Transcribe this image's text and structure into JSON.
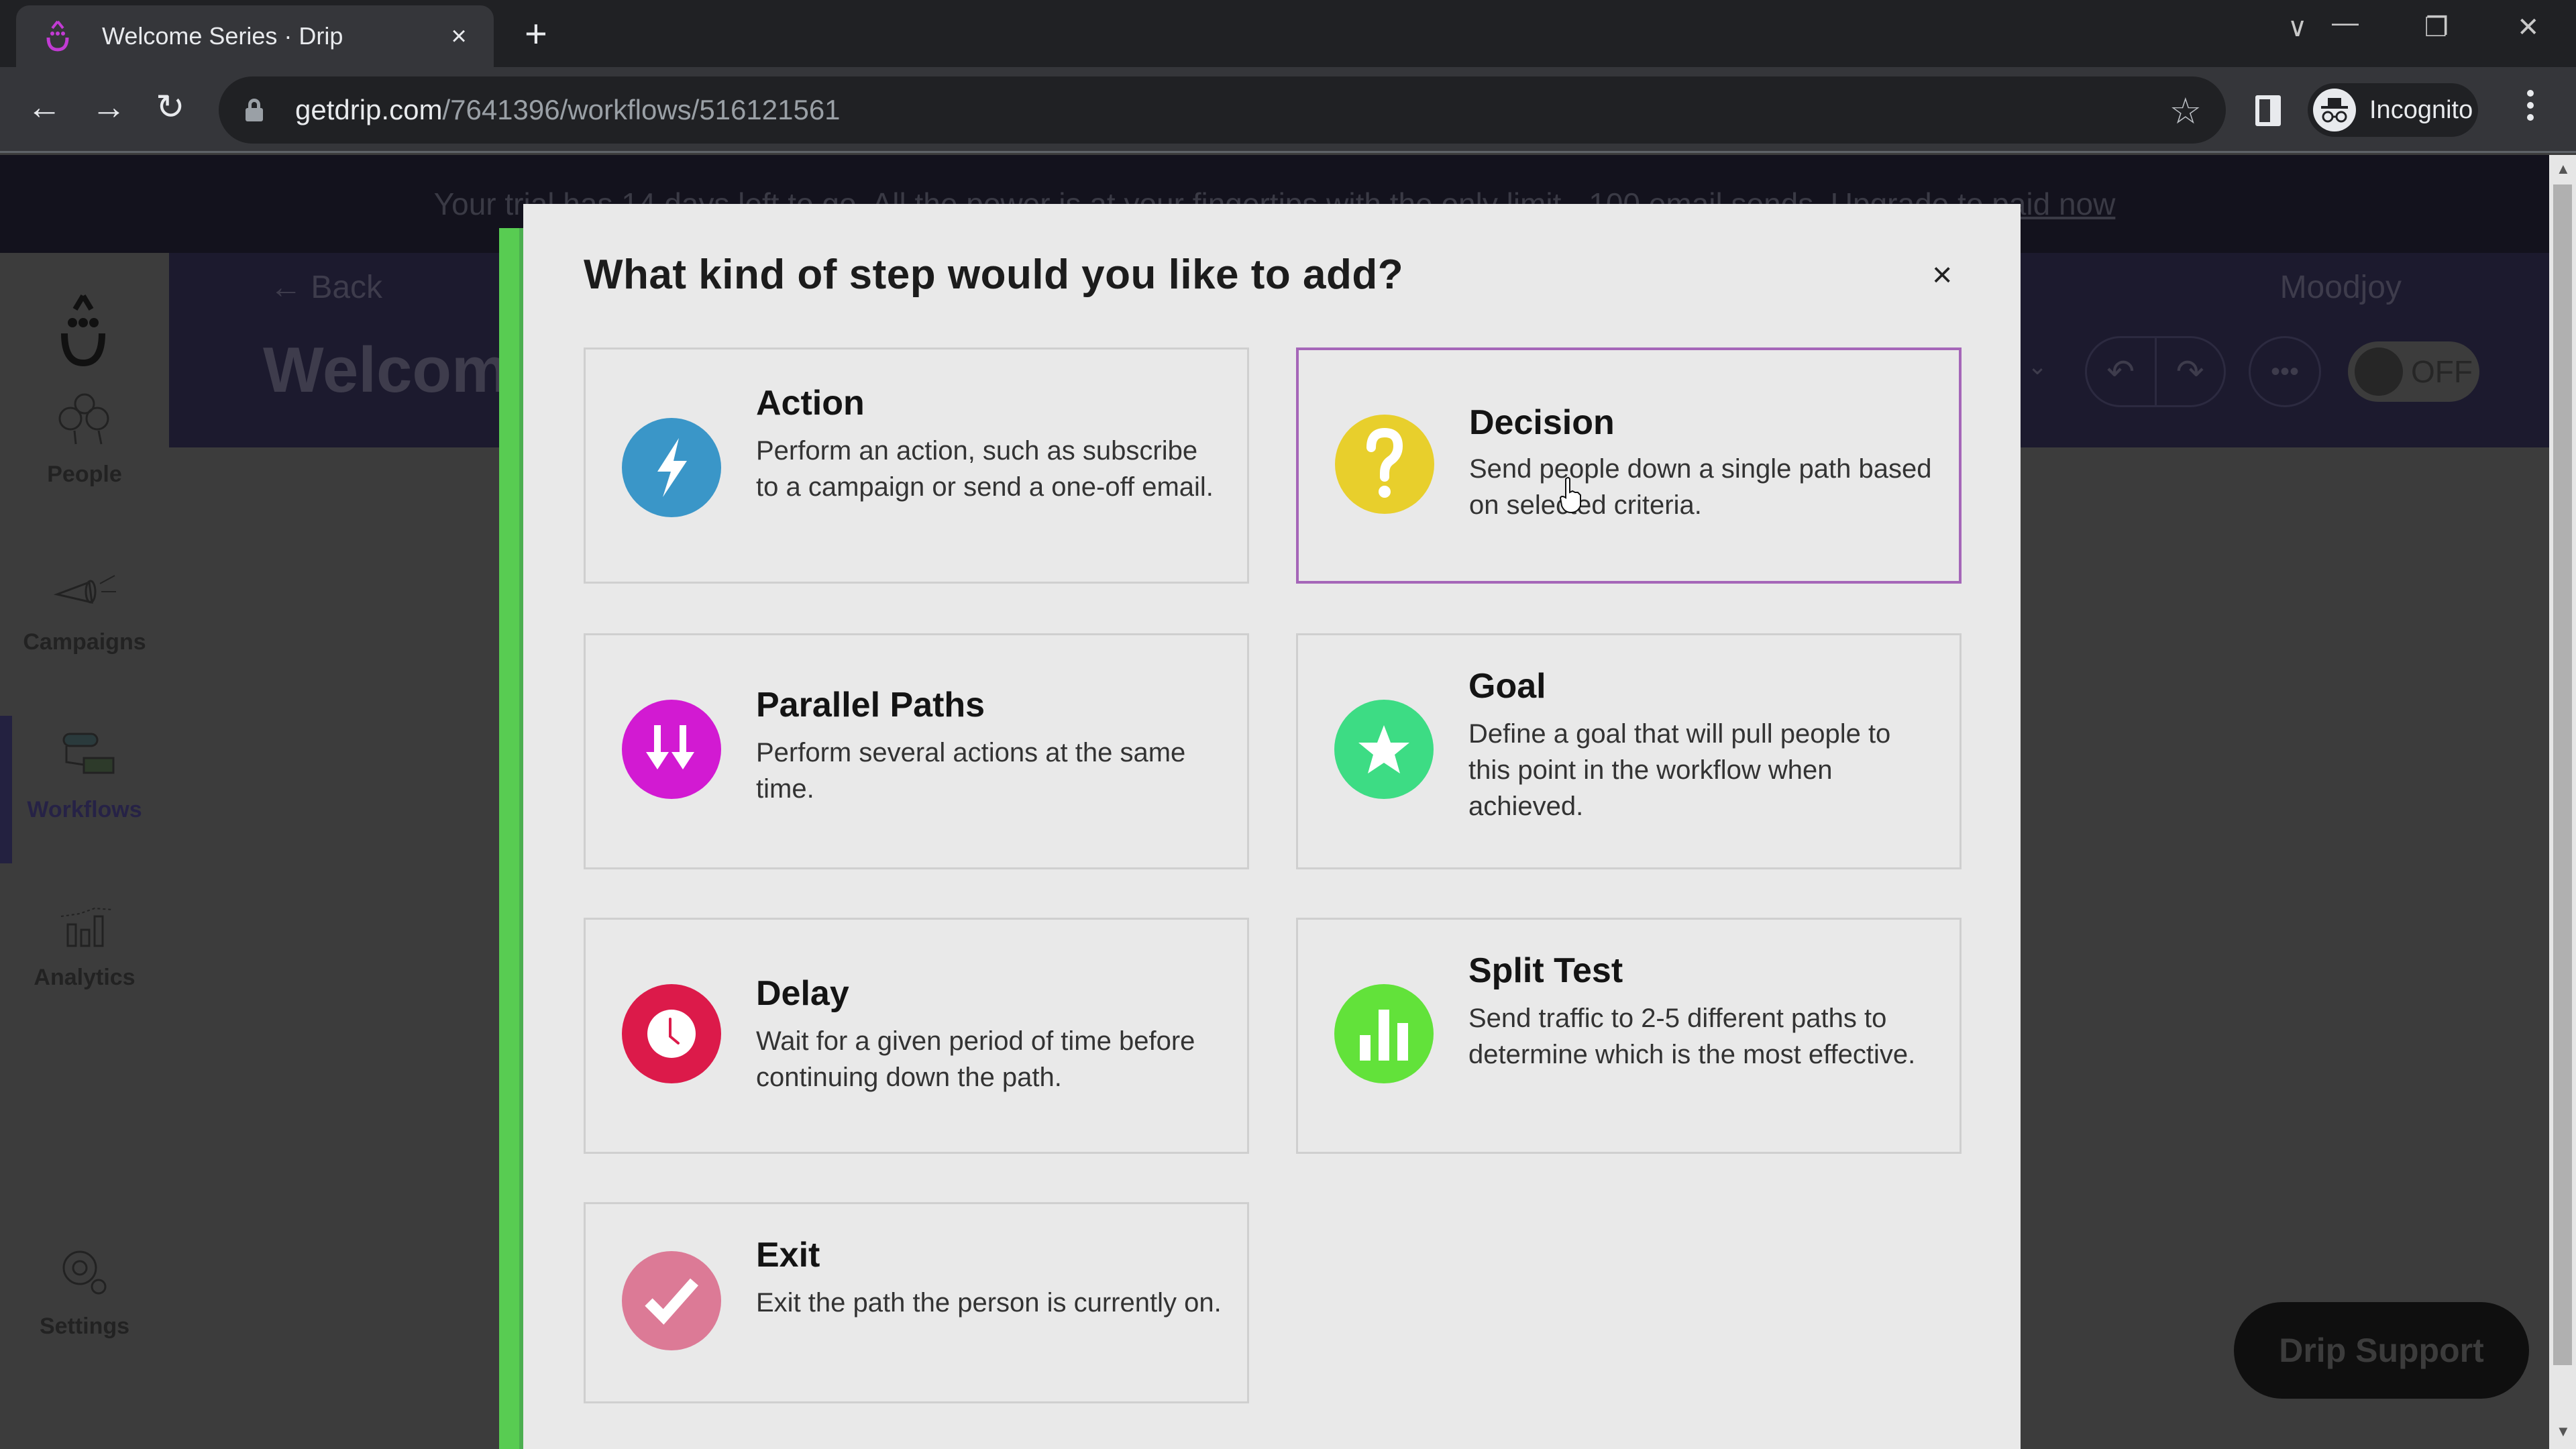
{
  "browser": {
    "tab_title": "Welcome Series · Drip",
    "tab_close": "×",
    "new_tab": "+",
    "url_host": "getdrip.com",
    "url_path": "/7641396/workflows/516121561",
    "profile_label": "Incognito",
    "window_controls": {
      "tab_search": "∨",
      "minimize": "—",
      "restore": "❐",
      "close": "✕"
    },
    "nav": {
      "back": "←",
      "forward": "→",
      "reload": "↻"
    },
    "bookmark_icon": "☆"
  },
  "banner": {
    "text_visible_start": "Your trial has 14 days left to go. All the power is at your fingertips with the only limit - 100 email sends. Upgrade",
    "link_text": " to paid now"
  },
  "sidebar": {
    "items": [
      {
        "label": "People",
        "icon": "people-icon"
      },
      {
        "label": "Campaigns",
        "icon": "megaphone-icon"
      },
      {
        "label": "Workflows",
        "icon": "workflow-icon",
        "active": true
      },
      {
        "label": "Analytics",
        "icon": "analytics-icon"
      },
      {
        "label": "Settings",
        "icon": "gear-icon"
      }
    ]
  },
  "header": {
    "back_label": "← Back",
    "workflow_title": "Welcome Series",
    "account_name": "Moodjoy",
    "chevron": "⌄",
    "undo": "↶",
    "redo": "↷",
    "more": "•••",
    "toggle_label": "OFF",
    "toggle_on": false
  },
  "support_button": "Drip Support",
  "modal": {
    "title": "What kind of step would you like to add?",
    "close": "×",
    "selected": "Decision",
    "options": [
      {
        "title": "Action",
        "description": "Perform an action, such as subscribe to a campaign or send a one-off email.",
        "icon": "lightning-icon",
        "color": "#3a96c8"
      },
      {
        "title": "Decision",
        "description": "Send people down a single path based on selected criteria.",
        "icon": "question-icon",
        "color": "#e8cf2c"
      },
      {
        "title": "Parallel Paths",
        "description": "Perform several actions at the same time.",
        "icon": "parallel-arrows-icon",
        "color": "#d21ad2"
      },
      {
        "title": "Goal",
        "description": "Define a goal that will pull people to this point in the workflow when achieved.",
        "icon": "star-icon",
        "color": "#3ddc84"
      },
      {
        "title": "Delay",
        "description": "Wait for a given period of time before continuing down the path.",
        "icon": "clock-icon",
        "color": "#dc1a4a"
      },
      {
        "title": "Split Test",
        "description": "Send traffic to 2-5 different paths to determine which is the most effective.",
        "icon": "bar-chart-icon",
        "color": "#62e23a"
      },
      {
        "title": "Exit",
        "description": "Exit the path the person is currently on.",
        "icon": "checkmark-icon",
        "color": "#dc7a96"
      }
    ]
  }
}
